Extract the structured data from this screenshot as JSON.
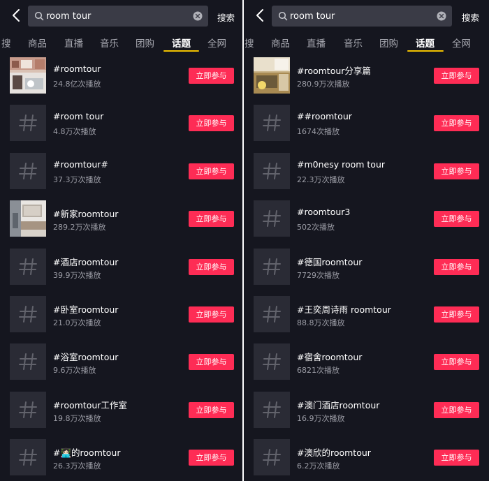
{
  "colors": {
    "background": "#15161f",
    "accent": "#fe2c55",
    "tab_indicator": "#f2c200"
  },
  "left": {
    "search": {
      "query": "room tour",
      "button": "搜索"
    },
    "tabs": [
      "搜",
      "商品",
      "直播",
      "音乐",
      "团购",
      "话题",
      "全网"
    ],
    "active_tab": "话题",
    "items": [
      {
        "title": "#roomtour",
        "plays": "24.8亿次播放",
        "button": "立即参与",
        "thumb": "photo-room"
      },
      {
        "title": "#room tour",
        "plays": "4.8万次播放",
        "button": "立即参与",
        "thumb": "hash-icon"
      },
      {
        "title": "#roomtour#",
        "plays": "37.3万次播放",
        "button": "立即参与",
        "thumb": "hash-icon"
      },
      {
        "title": "#新家roomtour",
        "plays": "289.2万次播放",
        "button": "立即参与",
        "thumb": "photo-livingroom"
      },
      {
        "title": "#酒店roomtour",
        "plays": "39.9万次播放",
        "button": "立即参与",
        "thumb": "hash-icon"
      },
      {
        "title": "#卧室roomtour",
        "plays": "21.0万次播放",
        "button": "立即参与",
        "thumb": "hash-icon"
      },
      {
        "title": "#浴室roomtour",
        "plays": "9.6万次播放",
        "button": "立即参与",
        "thumb": "hash-icon"
      },
      {
        "title": "#roomtour工作室",
        "plays": "19.8万次播放",
        "button": "立即参与",
        "thumb": "hash-icon"
      },
      {
        "title": "#👩🏻‍💻的roomtour",
        "plays": "26.3万次播放",
        "button": "立即参与",
        "thumb": "hash-icon"
      }
    ]
  },
  "right": {
    "search": {
      "query": "room tour",
      "button": "搜索"
    },
    "tabs": [
      "搜",
      "商品",
      "直播",
      "音乐",
      "团购",
      "话题",
      "全网"
    ],
    "active_tab": "话题",
    "items": [
      {
        "title": "#roomtour分享篇",
        "plays": "280.9万次播放",
        "button": "立即参与",
        "thumb": "photo-bedroom"
      },
      {
        "title": "##roomtour",
        "plays": "1674次播放",
        "button": "立即参与",
        "thumb": "hash-icon"
      },
      {
        "title": "#m0nesy room tour",
        "plays": "22.3万次播放",
        "button": "立即参与",
        "thumb": "hash-icon"
      },
      {
        "title": "#roomtour3",
        "plays": "502次播放",
        "button": "立即参与",
        "thumb": "hash-icon"
      },
      {
        "title": "#德国roomtour",
        "plays": "7729次播放",
        "button": "立即参与",
        "thumb": "hash-icon"
      },
      {
        "title": "#王奕周诗雨 roomtour",
        "plays": "88.8万次播放",
        "button": "立即参与",
        "thumb": "hash-icon"
      },
      {
        "title": "#宿舍roomtour",
        "plays": "6821次播放",
        "button": "立即参与",
        "thumb": "hash-icon"
      },
      {
        "title": "#澳门酒店roomtour",
        "plays": "16.9万次播放",
        "button": "立即参与",
        "thumb": "hash-icon"
      },
      {
        "title": "#澳欣的roomtour",
        "plays": "6.2万次播放",
        "button": "立即参与",
        "thumb": "hash-icon"
      }
    ]
  }
}
